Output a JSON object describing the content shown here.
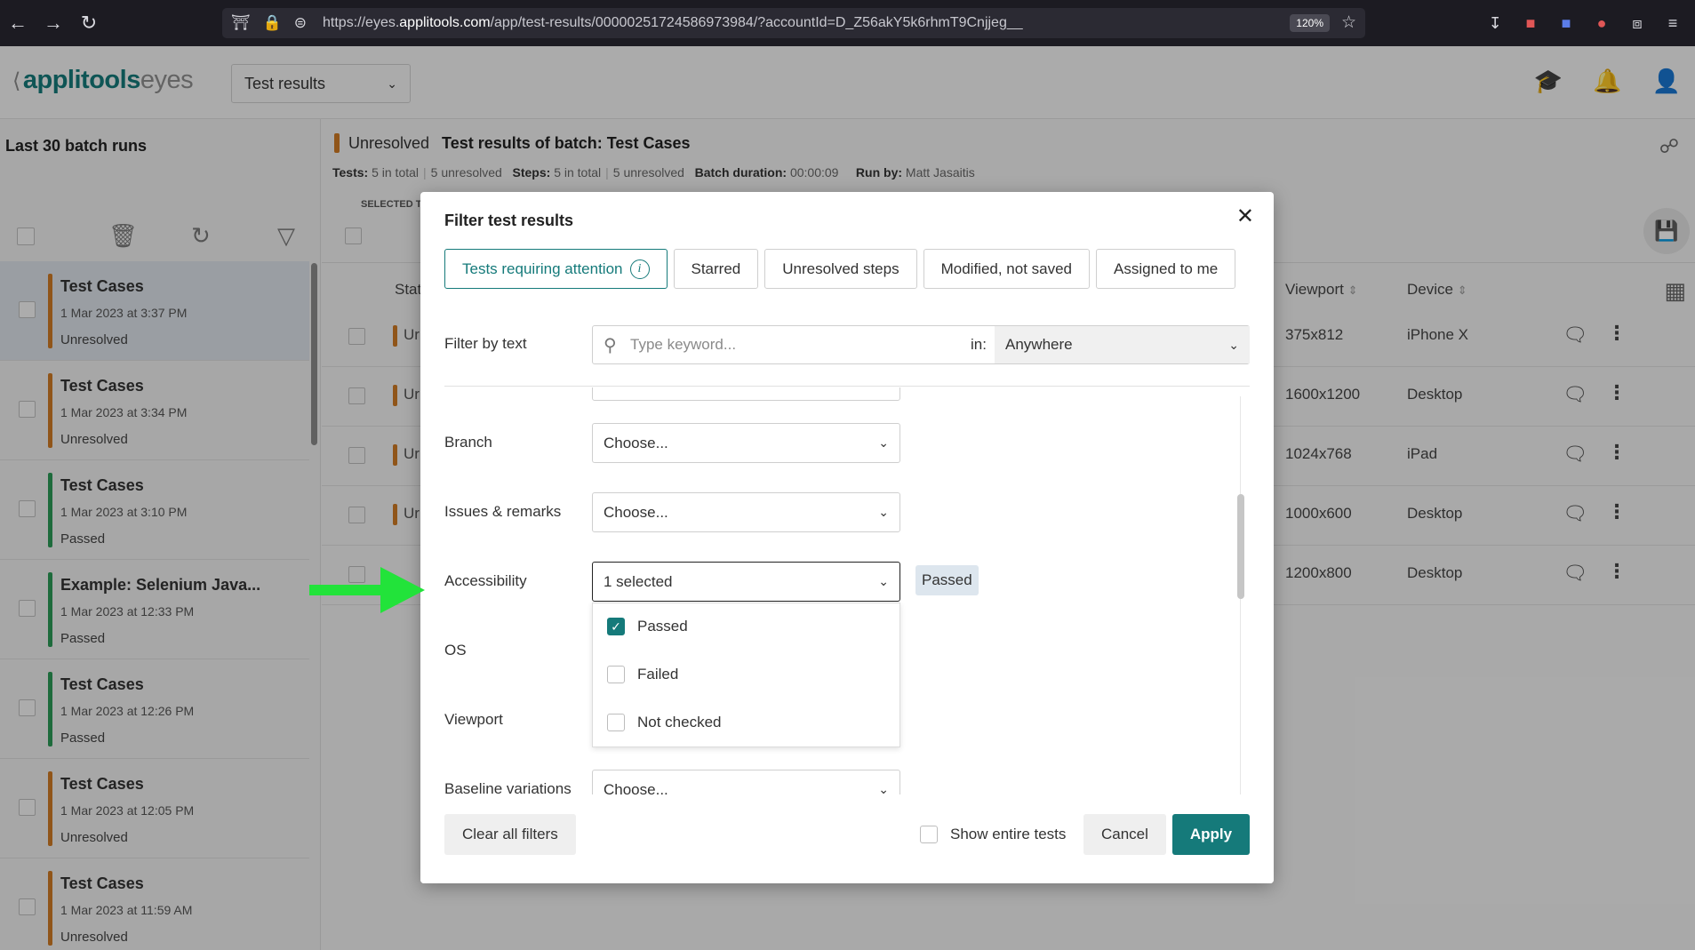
{
  "browser": {
    "url_prefix": "https://eyes.",
    "url_domain": "applitools.com",
    "url_rest": "/app/test-results/00000251724586973984/?accountId=D_Z56akY5k6rhmT9Cnjjeg__",
    "zoom": "120%"
  },
  "app": {
    "logo_brand": "applitools",
    "logo_sub": "eyes",
    "section_select": "Test results"
  },
  "sidebar": {
    "title": "Last 30 batch runs",
    "batches": [
      {
        "name": "Test Cases",
        "date": "1 Mar 2023 at 3:37 PM",
        "status": "Unresolved",
        "color": "#cf7a25"
      },
      {
        "name": "Test Cases",
        "date": "1 Mar 2023 at 3:34 PM",
        "status": "Unresolved",
        "color": "#cf7a25"
      },
      {
        "name": "Test Cases",
        "date": "1 Mar 2023 at 3:10 PM",
        "status": "Passed",
        "color": "#2c9a56"
      },
      {
        "name": "Example: Selenium Java...",
        "date": "1 Mar 2023 at 12:33 PM",
        "status": "Passed",
        "color": "#2c9a56"
      },
      {
        "name": "Test Cases",
        "date": "1 Mar 2023 at 12:26 PM",
        "status": "Passed",
        "color": "#2c9a56"
      },
      {
        "name": "Test Cases",
        "date": "1 Mar 2023 at 12:05 PM",
        "status": "Unresolved",
        "color": "#cf7a25"
      },
      {
        "name": "Test Cases",
        "date": "1 Mar 2023 at 11:59 AM",
        "status": "Unresolved",
        "color": "#cf7a25"
      }
    ]
  },
  "batch": {
    "status": "Unresolved",
    "title_prefix": "Test results of batch:",
    "title_name": "Test Cases",
    "tests_label": "Tests:",
    "tests_total": "5 in total",
    "tests_unresolved": "5 unresolved",
    "steps_label": "Steps:",
    "steps_total": "5 in total",
    "steps_unresolved": "5 unresolved",
    "duration_label": "Batch duration:",
    "duration": "00:00:09",
    "runby_label": "Run by:",
    "runby": "Matt Jasaitis",
    "selected_label": "SELECTED T"
  },
  "table": {
    "col_status": "Stat",
    "col_viewport": "Viewport",
    "col_device": "Device",
    "rows": [
      {
        "status": "Ur",
        "viewport": "375x812",
        "device": "iPhone X"
      },
      {
        "status": "Ur",
        "viewport": "1600x1200",
        "device": "Desktop"
      },
      {
        "status": "Ur",
        "viewport": "1024x768",
        "device": "iPad"
      },
      {
        "status": "Ur",
        "viewport": "1000x600",
        "device": "Desktop"
      },
      {
        "status": "",
        "viewport": "1200x800",
        "device": "Desktop"
      }
    ]
  },
  "dialog": {
    "title": "Filter test results",
    "chips": {
      "attention": "Tests requiring attention",
      "starred": "Starred",
      "unresolved": "Unresolved steps",
      "modified": "Modified, not saved",
      "assigned": "Assigned to me"
    },
    "filter_by_text": "Filter by text",
    "search_placeholder": "Type keyword...",
    "in_label": "in:",
    "in_value": "Anywhere",
    "branch_label": "Branch",
    "branch_value": "Choose...",
    "issues_label": "Issues & remarks",
    "issues_value": "Choose...",
    "accessibility_label": "Accessibility",
    "accessibility_value": "1 selected",
    "accessibility_tag": "Passed",
    "os_label": "OS",
    "viewport_label": "Viewport",
    "baseline_label": "Baseline variations",
    "baseline_value": "Choose...",
    "options": {
      "passed": "Passed",
      "failed": "Failed",
      "not_checked": "Not checked"
    },
    "clear_all": "Clear all filters",
    "show_entire": "Show entire tests",
    "cancel": "Cancel",
    "apply": "Apply"
  },
  "colors": {
    "accent": "#157a7a",
    "unresolved": "#cf7a25",
    "passed": "#2c9a56",
    "annotation_arrow": "#22e33a"
  }
}
